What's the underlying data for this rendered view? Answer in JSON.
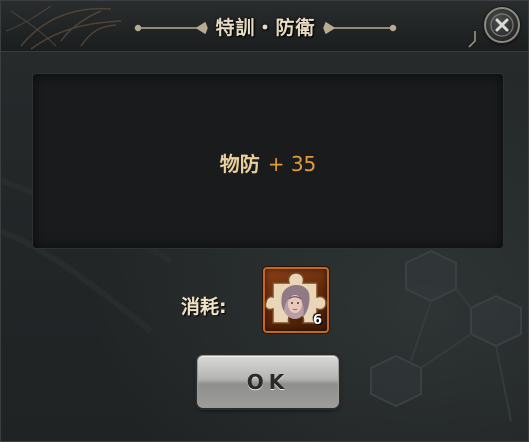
{
  "dialog": {
    "title": "特訓・防衛"
  },
  "result": {
    "stat_name": "物防",
    "stat_value": "+ 35"
  },
  "cost": {
    "label": "消耗:",
    "item_icon": "portrait-puzzle-piece-icon",
    "item_count": "6"
  },
  "buttons": {
    "ok_label": "OK",
    "close_icon": "close-icon"
  },
  "colors": {
    "title_text": "#e8dcc2",
    "stat_name": "#e9cf9c",
    "stat_value": "#e59a3b",
    "item_frame": "#c06a2a"
  }
}
